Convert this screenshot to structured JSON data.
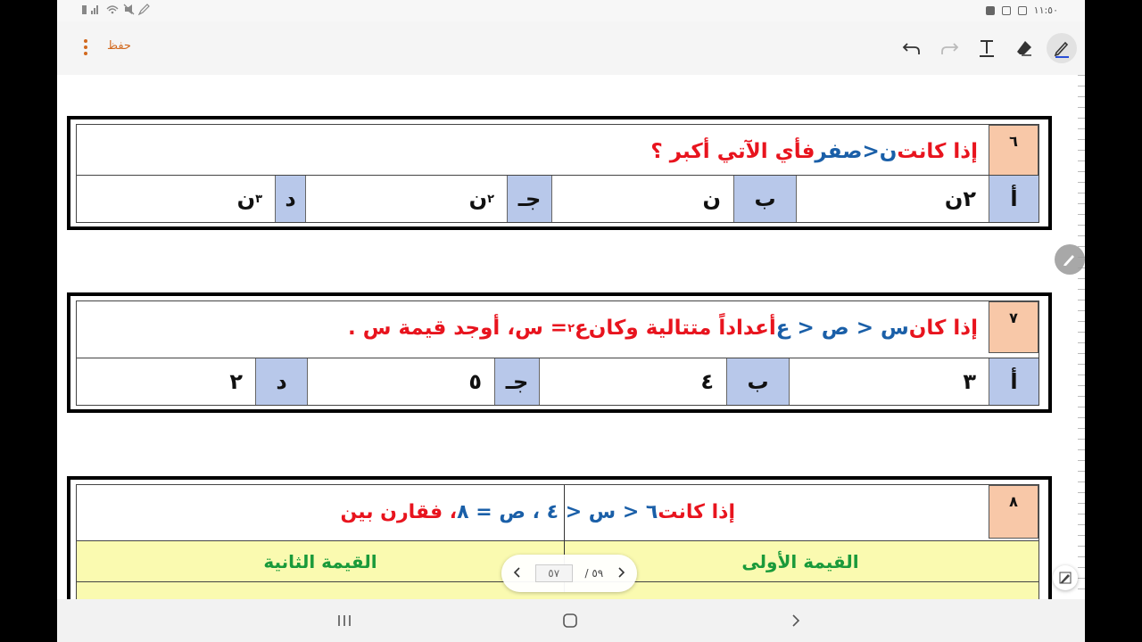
{
  "status_bar": {
    "time": "١١:٥٠"
  },
  "toolbar": {
    "save_label": "حفظ"
  },
  "questions": [
    {
      "number": "٦",
      "text_parts": [
        "إذا كانت ",
        "ن",
        " < ",
        "صفر",
        " فأي الآتي أكبر ؟"
      ],
      "answers": [
        {
          "label": "أ",
          "value": "٢ن"
        },
        {
          "label": "ب",
          "value": "ن"
        },
        {
          "label": "جـ",
          "value": "ن",
          "sup": "٢"
        },
        {
          "label": "د",
          "value": "ن",
          "sup": "٣"
        }
      ]
    },
    {
      "number": "٧",
      "text_parts": [
        "إذا كان ",
        "س < ص < ع",
        " أعداداً متتالية وكان ",
        "ع",
        "٢",
        " = س ",
        "، أوجد قيمة س ."
      ],
      "answers": [
        {
          "label": "أ",
          "value": "٣"
        },
        {
          "label": "ب",
          "value": "٤"
        },
        {
          "label": "جـ",
          "value": "٥"
        },
        {
          "label": "د",
          "value": "٢"
        }
      ]
    },
    {
      "number": "٨",
      "text_parts": [
        "إذا كانت ",
        "٦ < س < ٤ ، ص = ٨",
        " ، فقارن بين"
      ],
      "col_first": "القيمة الأولى",
      "col_second": "القيمة الثانية"
    }
  ],
  "pager": {
    "current": "٥٧",
    "total": "/ ٥٩"
  }
}
